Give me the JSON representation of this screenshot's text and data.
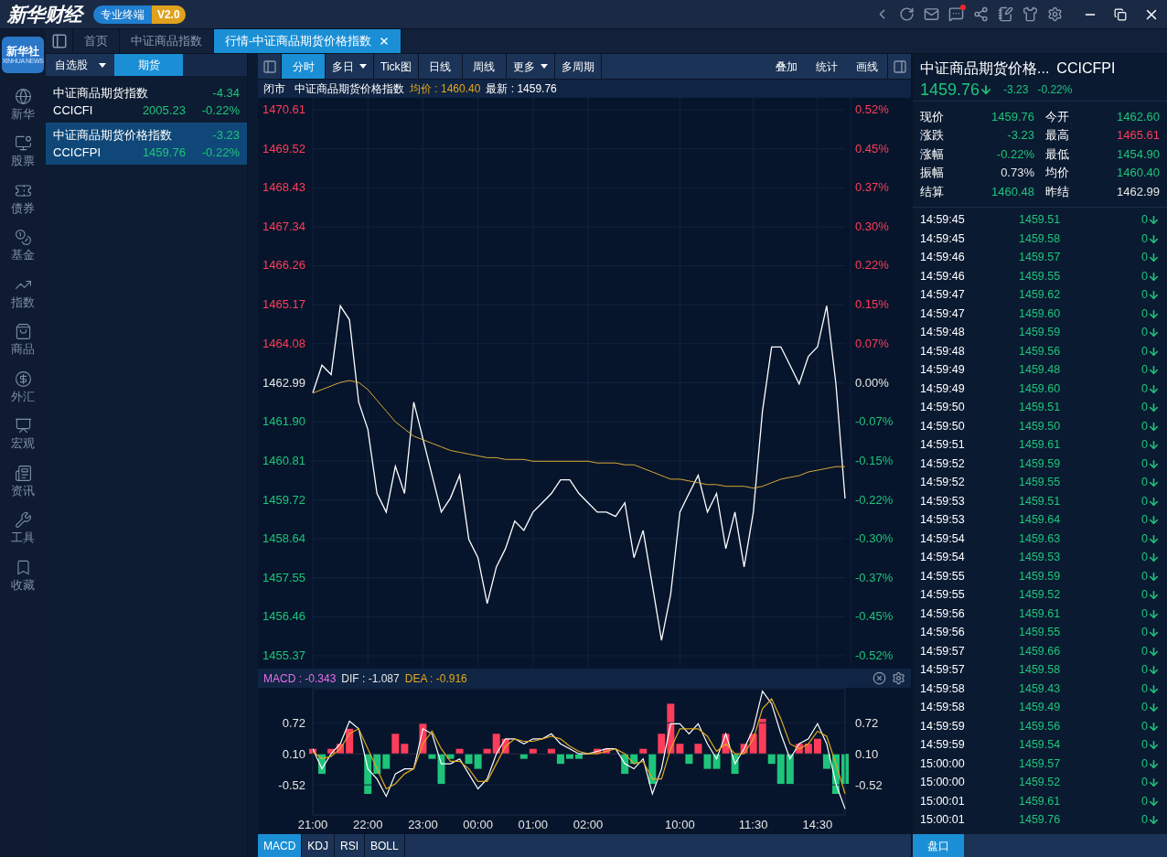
{
  "titlebar": {
    "logo": "新华财经",
    "badge": "专业终端",
    "version": "V2.0",
    "notification_dot": true
  },
  "nav": {
    "logo_text": "新华社",
    "logo_subtext": "XINHUA NEWS",
    "items": [
      {
        "label": "新华"
      },
      {
        "label": "股票"
      },
      {
        "label": "债券"
      },
      {
        "label": "基金"
      },
      {
        "label": "指数"
      },
      {
        "label": "商品"
      },
      {
        "label": "外汇"
      },
      {
        "label": "宏观"
      },
      {
        "label": "资讯"
      },
      {
        "label": "工具"
      },
      {
        "label": "收藏"
      }
    ]
  },
  "tabs": [
    {
      "label": "首页",
      "selected": false,
      "closable": false
    },
    {
      "label": "中证商品指数",
      "selected": false,
      "closable": false
    },
    {
      "label": "行情-中证商品期货价格指数",
      "selected": true,
      "closable": true
    }
  ],
  "watchlist": {
    "tabs": [
      {
        "label": "自选股",
        "selected": false,
        "dropdown": true
      },
      {
        "label": "期货",
        "selected": true,
        "dropdown": false
      }
    ],
    "items": [
      {
        "name": "中证商品期货指数",
        "code": "CCICFI",
        "price": "2005.23",
        "change": "-4.34",
        "pct": "-0.22%",
        "color": "#1ec47b",
        "selected": false
      },
      {
        "name": "中证商品期货价格指数",
        "code": "CCICFPI",
        "price": "1459.76",
        "change": "-3.23",
        "pct": "-0.22%",
        "color": "#1ec47b",
        "selected": true
      }
    ]
  },
  "chart_toolbar": {
    "periods": [
      {
        "label": "分时",
        "selected": true,
        "dropdown": false
      },
      {
        "label": "多日",
        "selected": false,
        "dropdown": true
      },
      {
        "label": "Tick图",
        "selected": false,
        "dropdown": false
      },
      {
        "label": "日线",
        "selected": false,
        "dropdown": false
      },
      {
        "label": "周线",
        "selected": false,
        "dropdown": false
      },
      {
        "label": "更多",
        "selected": false,
        "dropdown": true
      },
      {
        "label": "多周期",
        "selected": false,
        "dropdown": false
      }
    ],
    "tools": [
      "叠加",
      "统计",
      "画线"
    ]
  },
  "info_line": {
    "status": "闭市",
    "name": "中证商品期货价格指数",
    "avg": "均价 : 1460.40",
    "latest": "最新 : 1459.76"
  },
  "price_chart": {
    "percent_labels": [
      {
        "text": "0.52%",
        "color": "#ff3d5a"
      },
      {
        "text": "0.45%",
        "color": "#ff3d5a"
      },
      {
        "text": "0.37%",
        "color": "#ff3d5a"
      },
      {
        "text": "0.30%",
        "color": "#ff3d5a"
      },
      {
        "text": "0.22%",
        "color": "#ff3d5a"
      },
      {
        "text": "0.15%",
        "color": "#ff3d5a"
      },
      {
        "text": "0.07%",
        "color": "#ff3d5a"
      },
      {
        "text": "0.00%",
        "color": "#e6e6e6"
      },
      {
        "text": "-0.07%",
        "color": "#1ec47b"
      },
      {
        "text": "-0.15%",
        "color": "#1ec47b"
      },
      {
        "text": "-0.22%",
        "color": "#1ec47b"
      },
      {
        "text": "-0.30%",
        "color": "#1ec47b"
      },
      {
        "text": "-0.37%",
        "color": "#1ec47b"
      },
      {
        "text": "-0.45%",
        "color": "#1ec47b"
      },
      {
        "text": "-0.52%",
        "color": "#1ec47b"
      }
    ],
    "chart_data": {
      "type": "line",
      "grid": true,
      "ylim": [
        1455.37,
        1470.61
      ],
      "yticks": [
        {
          "value": 1470.61,
          "label": "1470.61"
        },
        {
          "value": 1469.52,
          "label": "1469.52"
        },
        {
          "value": 1468.43,
          "label": "1468.43"
        },
        {
          "value": 1467.34,
          "label": "1467.34"
        },
        {
          "value": 1466.26,
          "label": "1466.26"
        },
        {
          "value": 1465.17,
          "label": "1465.17"
        },
        {
          "value": 1464.08,
          "label": "1464.08"
        },
        {
          "value": 1462.99,
          "label": "1462.99"
        },
        {
          "value": 1461.9,
          "label": "1461.90"
        },
        {
          "value": 1460.81,
          "label": "1460.81"
        },
        {
          "value": 1459.72,
          "label": "1459.72"
        },
        {
          "value": 1458.64,
          "label": "1458.64"
        },
        {
          "value": 1457.55,
          "label": "1457.55"
        },
        {
          "value": 1456.46,
          "label": "1456.46"
        },
        {
          "value": 1455.37,
          "label": "1455.37"
        }
      ],
      "series": [
        {
          "color": "#ffffff",
          "values": [
            1462.71,
            1463.48,
            1463.22,
            1465.14,
            1464.75,
            1462.45,
            1461.69,
            1459.9,
            1459.38,
            1460.66,
            1459.9,
            1462.45,
            1461.43,
            1460.41,
            1459.38,
            1459.77,
            1460.41,
            1458.62,
            1458.11,
            1456.83,
            1457.85,
            1458.36,
            1459.13,
            1458.87,
            1459.38,
            1459.64,
            1459.9,
            1460.28,
            1460.28,
            1459.9,
            1459.64,
            1459.38,
            1459.38,
            1459.26,
            1459.64,
            1458.11,
            1458.87,
            1457.34,
            1455.8,
            1457.08,
            1459.38,
            1459.9,
            1460.41,
            1459.38,
            1459.9,
            1458.36,
            1459.38,
            1457.85,
            1459.38,
            1462.2,
            1463.99,
            1463.99,
            1463.48,
            1462.96,
            1463.73,
            1463.99,
            1465.14,
            1462.96,
            1459.76
          ]
        },
        {
          "color": "#d9a93a",
          "values": [
            1462.7,
            1462.8,
            1462.9,
            1463.0,
            1463.05,
            1463.0,
            1462.8,
            1462.5,
            1462.2,
            1461.9,
            1461.7,
            1461.5,
            1461.4,
            1461.3,
            1461.2,
            1461.1,
            1461.05,
            1461.0,
            1460.95,
            1460.9,
            1460.9,
            1460.85,
            1460.85,
            1460.85,
            1460.8,
            1460.8,
            1460.8,
            1460.8,
            1460.8,
            1460.8,
            1460.8,
            1460.75,
            1460.75,
            1460.75,
            1460.7,
            1460.7,
            1460.6,
            1460.5,
            1460.4,
            1460.3,
            1460.3,
            1460.25,
            1460.2,
            1460.15,
            1460.15,
            1460.1,
            1460.1,
            1460.1,
            1460.05,
            1460.1,
            1460.2,
            1460.3,
            1460.35,
            1460.4,
            1460.5,
            1460.55,
            1460.6,
            1460.65,
            1460.65
          ]
        }
      ]
    }
  },
  "macd_panel": {
    "readouts": [
      {
        "text": "MACD : -0.343",
        "color": "#e86ee8"
      },
      {
        "text": "DIF : -1.087",
        "color": "#e6e6e6"
      },
      {
        "text": "DEA : -0.916",
        "color": "#e0a91e"
      }
    ],
    "time_labels": [
      "21:00",
      "22:00",
      "23:00",
      "00:00",
      "01:00",
      "02:00",
      "10:00",
      "11:30",
      "14:30"
    ],
    "chart_data": {
      "type": "line",
      "grid": true,
      "ylim": [
        -1.12,
        1.4
      ],
      "yticks": [
        {
          "value": 0.72,
          "label": "0.72"
        },
        {
          "value": 0.1,
          "label": "0.10"
        },
        {
          "value": -0.52,
          "label": "-0.52"
        }
      ],
      "series": [
        {
          "color": "#ffffff",
          "values": [
            0.2,
            -0.2,
            0.1,
            0.3,
            0.75,
            0.6,
            -0.2,
            -0.4,
            -0.75,
            -0.3,
            -0.2,
            -0.2,
            0.6,
            0.5,
            -0.1,
            -0.1,
            0.0,
            -0.3,
            -0.6,
            -0.4,
            0.1,
            0.4,
            0.4,
            0.3,
            0.4,
            0.4,
            0.5,
            0.3,
            0.2,
            0.1,
            0.1,
            0.15,
            0.2,
            0.2,
            -0.1,
            -0.2,
            0.0,
            -0.7,
            -0.2,
            0.7,
            0.7,
            0.5,
            0.7,
            0.3,
            0.0,
            0.5,
            -0.1,
            0.2,
            0.6,
            1.35,
            1.1,
            0.5,
            0.0,
            0.3,
            0.4,
            0.7,
            0.3,
            -0.5,
            -1.0
          ]
        },
        {
          "color": "#e0a91e",
          "values": [
            0.15,
            0.0,
            0.05,
            0.2,
            0.5,
            0.6,
            0.2,
            -0.2,
            -0.6,
            -0.5,
            -0.3,
            -0.2,
            0.3,
            0.55,
            0.2,
            -0.05,
            -0.05,
            -0.2,
            -0.45,
            -0.45,
            -0.1,
            0.25,
            0.4,
            0.35,
            0.35,
            0.4,
            0.45,
            0.4,
            0.25,
            0.15,
            0.1,
            0.1,
            0.15,
            0.2,
            0.1,
            -0.1,
            -0.05,
            -0.4,
            -0.4,
            0.2,
            0.6,
            0.6,
            0.6,
            0.45,
            0.15,
            0.3,
            0.1,
            0.1,
            0.4,
            1.0,
            1.2,
            0.8,
            0.3,
            0.2,
            0.3,
            0.55,
            0.45,
            -0.1,
            -0.7
          ]
        }
      ]
    }
  },
  "indicator_tabs": [
    {
      "label": "MACD",
      "selected": true
    },
    {
      "label": "KDJ",
      "selected": false
    },
    {
      "label": "RSI",
      "selected": false
    },
    {
      "label": "BOLL",
      "selected": false
    }
  ],
  "quote": {
    "title": "中证商品期货价格...",
    "code": "CCICFPI",
    "price": "1459.76",
    "color": "#1ec47b",
    "arrow_down": true,
    "change": "-3.23",
    "pct": "-0.22%",
    "stats": [
      {
        "label": "现价",
        "value": "1459.76",
        "color": "#1ec47b"
      },
      {
        "label": "今开",
        "value": "1462.60",
        "color": "#1ec47b"
      },
      {
        "label": "涨跌",
        "value": "-3.23",
        "color": "#1ec47b"
      },
      {
        "label": "最高",
        "value": "1465.61",
        "color": "#ff3d5a"
      },
      {
        "label": "涨幅",
        "value": "-0.22%",
        "color": "#1ec47b"
      },
      {
        "label": "最低",
        "value": "1454.90",
        "color": "#1ec47b"
      },
      {
        "label": "振幅",
        "value": "0.73%",
        "color": "#e6e6e6"
      },
      {
        "label": "均价",
        "value": "1460.40",
        "color": "#1ec47b"
      },
      {
        "label": "结算",
        "value": "1460.48",
        "color": "#1ec47b"
      },
      {
        "label": "昨结",
        "value": "1462.99",
        "color": "#e6e6e6"
      }
    ]
  },
  "trades": [
    {
      "time": "14:59:45",
      "price": "1459.51",
      "volume": "0",
      "color": "#1ec47b",
      "arrow_down": true
    },
    {
      "time": "14:59:45",
      "price": "1459.58",
      "volume": "0",
      "color": "#1ec47b",
      "arrow_down": true
    },
    {
      "time": "14:59:46",
      "price": "1459.57",
      "volume": "0",
      "color": "#1ec47b",
      "arrow_down": true
    },
    {
      "time": "14:59:46",
      "price": "1459.55",
      "volume": "0",
      "color": "#1ec47b",
      "arrow_down": true
    },
    {
      "time": "14:59:47",
      "price": "1459.62",
      "volume": "0",
      "color": "#1ec47b",
      "arrow_down": true
    },
    {
      "time": "14:59:47",
      "price": "1459.60",
      "volume": "0",
      "color": "#1ec47b",
      "arrow_down": true
    },
    {
      "time": "14:59:48",
      "price": "1459.59",
      "volume": "0",
      "color": "#1ec47b",
      "arrow_down": true
    },
    {
      "time": "14:59:48",
      "price": "1459.56",
      "volume": "0",
      "color": "#1ec47b",
      "arrow_down": true
    },
    {
      "time": "14:59:49",
      "price": "1459.48",
      "volume": "0",
      "color": "#1ec47b",
      "arrow_down": true
    },
    {
      "time": "14:59:49",
      "price": "1459.60",
      "volume": "0",
      "color": "#1ec47b",
      "arrow_down": true
    },
    {
      "time": "14:59:50",
      "price": "1459.51",
      "volume": "0",
      "color": "#1ec47b",
      "arrow_down": true
    },
    {
      "time": "14:59:50",
      "price": "1459.50",
      "volume": "0",
      "color": "#1ec47b",
      "arrow_down": true
    },
    {
      "time": "14:59:51",
      "price": "1459.61",
      "volume": "0",
      "color": "#1ec47b",
      "arrow_down": true
    },
    {
      "time": "14:59:52",
      "price": "1459.59",
      "volume": "0",
      "color": "#1ec47b",
      "arrow_down": true
    },
    {
      "time": "14:59:52",
      "price": "1459.55",
      "volume": "0",
      "color": "#1ec47b",
      "arrow_down": true
    },
    {
      "time": "14:59:53",
      "price": "1459.51",
      "volume": "0",
      "color": "#1ec47b",
      "arrow_down": true
    },
    {
      "time": "14:59:53",
      "price": "1459.64",
      "volume": "0",
      "color": "#1ec47b",
      "arrow_down": true
    },
    {
      "time": "14:59:54",
      "price": "1459.63",
      "volume": "0",
      "color": "#1ec47b",
      "arrow_down": true
    },
    {
      "time": "14:59:54",
      "price": "1459.53",
      "volume": "0",
      "color": "#1ec47b",
      "arrow_down": true
    },
    {
      "time": "14:59:55",
      "price": "1459.59",
      "volume": "0",
      "color": "#1ec47b",
      "arrow_down": true
    },
    {
      "time": "14:59:55",
      "price": "1459.52",
      "volume": "0",
      "color": "#1ec47b",
      "arrow_down": true
    },
    {
      "time": "14:59:56",
      "price": "1459.61",
      "volume": "0",
      "color": "#1ec47b",
      "arrow_down": true
    },
    {
      "time": "14:59:56",
      "price": "1459.55",
      "volume": "0",
      "color": "#1ec47b",
      "arrow_down": true
    },
    {
      "time": "14:59:57",
      "price": "1459.66",
      "volume": "0",
      "color": "#1ec47b",
      "arrow_down": true
    },
    {
      "time": "14:59:57",
      "price": "1459.58",
      "volume": "0",
      "color": "#1ec47b",
      "arrow_down": true
    },
    {
      "time": "14:59:58",
      "price": "1459.43",
      "volume": "0",
      "color": "#1ec47b",
      "arrow_down": true
    },
    {
      "time": "14:59:58",
      "price": "1459.49",
      "volume": "0",
      "color": "#1ec47b",
      "arrow_down": true
    },
    {
      "time": "14:59:59",
      "price": "1459.56",
      "volume": "0",
      "color": "#1ec47b",
      "arrow_down": true
    },
    {
      "time": "14:59:59",
      "price": "1459.54",
      "volume": "0",
      "color": "#1ec47b",
      "arrow_down": true
    },
    {
      "time": "15:00:00",
      "price": "1459.57",
      "volume": "0",
      "color": "#1ec47b",
      "arrow_down": true
    },
    {
      "time": "15:00:00",
      "price": "1459.52",
      "volume": "0",
      "color": "#1ec47b",
      "arrow_down": true
    },
    {
      "time": "15:00:01",
      "price": "1459.61",
      "volume": "0",
      "color": "#1ec47b",
      "arrow_down": true
    },
    {
      "time": "15:00:01",
      "price": "1459.76",
      "volume": "0",
      "color": "#1ec47b",
      "arrow_down": true
    }
  ],
  "bottom_tab": {
    "label": "盘口",
    "selected": true
  }
}
